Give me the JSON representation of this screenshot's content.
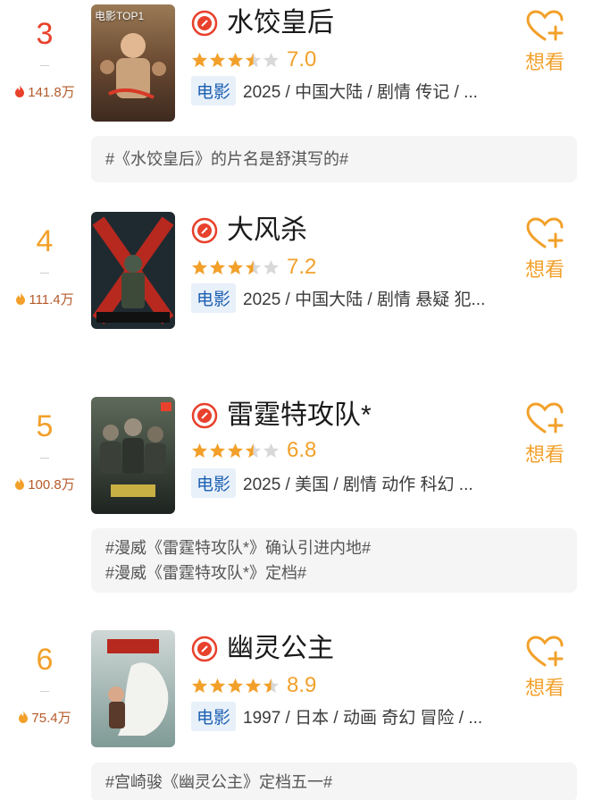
{
  "colors": {
    "accent": "#f2a02a",
    "rank_top": "#e8412c",
    "badge_bg": "#e8f0fa",
    "badge_text": "#1b5fb0"
  },
  "entries": [
    {
      "rank": "3",
      "heat": "141.8万",
      "poster_label": "电影TOP1",
      "title": "水饺皇后",
      "stars": 3.5,
      "score": "7.0",
      "category": "电影",
      "meta": "2025 / 中国大陆 / 剧情 传记 / ...",
      "want": "想看",
      "tags": [
        "#《水饺皇后》的片名是舒淇写的#"
      ]
    },
    {
      "rank": "4",
      "heat": "111.4万",
      "poster_label": "",
      "title": "大风杀",
      "stars": 3.5,
      "score": "7.2",
      "category": "电影",
      "meta": "2025 / 中国大陆 / 剧情 悬疑 犯...",
      "want": "想看",
      "tags": []
    },
    {
      "rank": "5",
      "heat": "100.8万",
      "poster_label": "",
      "title": "雷霆特攻队*",
      "stars": 3.5,
      "score": "6.8",
      "category": "电影",
      "meta": "2025 / 美国 / 剧情 动作 科幻 ...",
      "want": "想看",
      "tags": [
        "#漫威《雷霆特攻队*》确认引进内地#",
        "#漫威《雷霆特攻队*》定档#"
      ]
    },
    {
      "rank": "6",
      "heat": "75.4万",
      "poster_label": "",
      "title": "幽灵公主",
      "stars": 4.5,
      "score": "8.9",
      "category": "电影",
      "meta": "1997 / 日本 / 动画 奇幻 冒险 / ...",
      "want": "想看",
      "tags": [
        "#宫崎骏《幽灵公主》定档五一#"
      ]
    }
  ]
}
